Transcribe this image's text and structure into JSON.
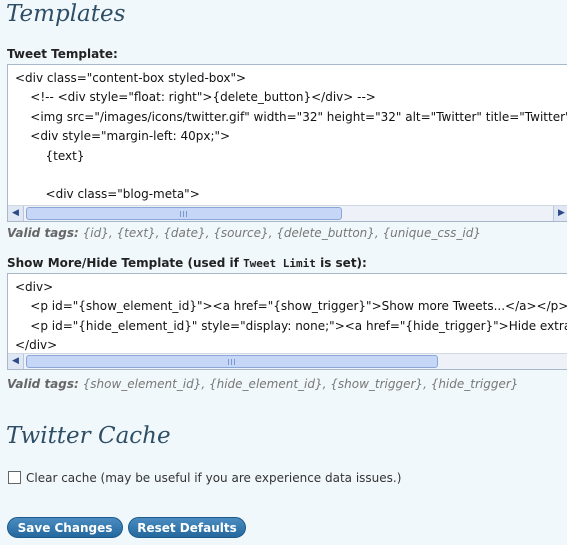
{
  "templates_section": {
    "title": "Templates",
    "tweet_label": "Tweet Template:",
    "tweet_lines": [
      "<div class=\"content-box styled-box\">",
      "    <!-- <div style=\"float: right\">{delete_button}</div> -->",
      "    <img src=\"/images/icons/twitter.gif\" width=\"32\" height=\"32\" alt=\"Twitter\" title=\"Twitter\" />",
      "    <div style=\"margin-left: 40px;\">",
      "        {text}",
      "",
      "        <div class=\"blog-meta\">"
    ],
    "tweet_valid_label": "Valid tags:",
    "tweet_valid_tags": "{id}, {text}, {date}, {source}, {delete_button}, {unique_css_id}",
    "showmore_label_pre": "Show More/Hide Template (used if ",
    "showmore_label_code": "Tweet Limit",
    "showmore_label_post": " is set):",
    "showmore_lines": [
      "<div>",
      "    <p id=\"{show_element_id}\"><a href=\"{show_trigger}\">Show more Tweets...</a></p>",
      "    <p id=\"{hide_element_id}\" style=\"display: none;\"><a href=\"{hide_trigger}\">Hide extra Tweets</a></p>",
      "</div>"
    ],
    "showmore_valid_label": "Valid tags:",
    "showmore_valid_tags": "{show_element_id}, {hide_element_id}, {show_trigger}, {hide_trigger}"
  },
  "cache_section": {
    "title": "Twitter Cache",
    "clear_cache_label": "Clear cache (may be useful if you are experience data issues.)"
  },
  "buttons": {
    "save": "Save Changes",
    "reset": "Reset Defaults"
  }
}
